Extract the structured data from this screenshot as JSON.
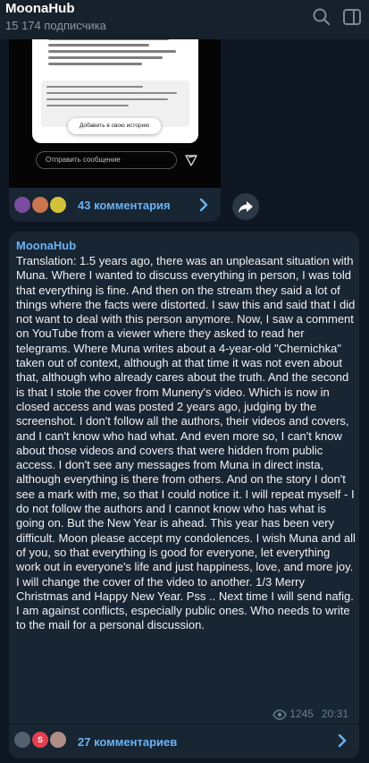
{
  "header": {
    "title": "MoonaHub",
    "subscribers": "15 174 подписчика"
  },
  "post1": {
    "screenshot": {
      "add_to_story": "Добавить в свою историю",
      "message_placeholder": "Отправить сообщение"
    },
    "comments_label": "43 комментария"
  },
  "post2": {
    "author": "MoonaHub",
    "text": "Translation: 1.5 years ago, there was an unpleasant situation with Muna.  Where I wanted to discuss everything in person, I was told that everything is fine.  And then on the stream they said a lot of things where the facts were distorted.  I saw this and said that I did not want to deal with this person anymore.  Now, I saw a comment on YouTube from a viewer where they asked to read her telegrams.  Where Muna writes about a 4-year-old \"Chernichka\" taken out of context, although at that time it was not even about that, although who already cares about the truth.  And the second is that I stole the cover from Muneny's video.  Which is now in closed access and was posted 2 years ago, judging by the screenshot.  I don't follow all the authors, their videos and covers, and I can't know who had what.  And even more so, I can't know about those videos and covers that were hidden from public access.  I don't see any messages from Muna in direct insta, although everything is there from others.  And on the story I don't see a mark with me, so that I could notice it.  I will repeat myself - I do not follow the authors and I cannot know who has what is going on.  But the New Year is ahead.  This year has been very difficult.  Moon please accept my condolences.  I wish Muna and all of you, so that everything is good for everyone, let everything work out in everyone's life and just happiness, love, and more joy.  I will change the cover of the video to another.  1/3 Merry Christmas and Happy New Year.  Pss .. Next time I will send nafig.  I am against conflicts, especially public ones.  Who needs to write to the mail for a personal discussion.",
    "views": "1245",
    "time": "20:31",
    "comments_label": "27 комментариев",
    "avatar_letter": "S"
  },
  "colors": {
    "background": "#0e1621",
    "bubble": "#182533",
    "accent": "#6ab3f3",
    "meta": "#6d7f8f"
  },
  "icons": [
    "search-icon",
    "side-panel-icon",
    "send-icon",
    "chevron-right-icon",
    "share-icon",
    "eye-icon"
  ]
}
